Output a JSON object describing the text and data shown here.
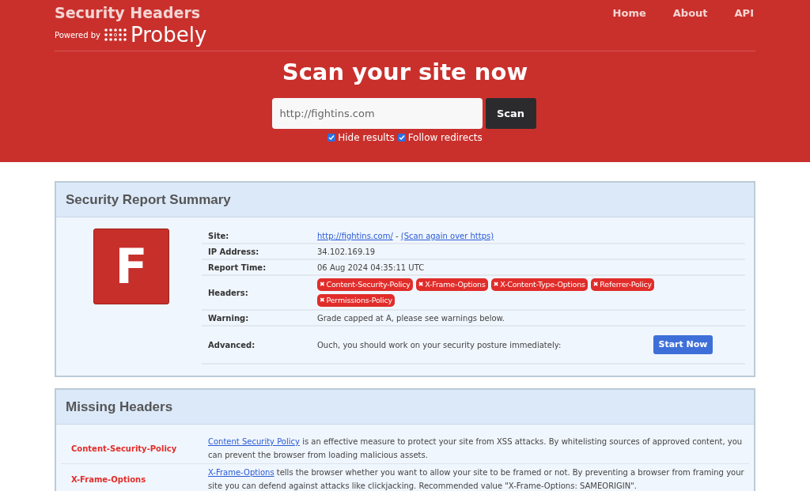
{
  "brand": {
    "title": "Security Headers",
    "powered_by": "Powered by",
    "partner": "Probely"
  },
  "nav": [
    "Home",
    "About",
    "API"
  ],
  "hero": {
    "title": "Scan your site now",
    "search": {
      "value": "http://fightins.com"
    },
    "button": "Scan",
    "options": [
      {
        "label": "Hide results",
        "checked": true
      },
      {
        "label": "Follow redirects",
        "checked": true
      }
    ]
  },
  "summary": {
    "title": "Security Report Summary",
    "grade": "F",
    "rows": [
      {
        "kind": "site",
        "label": "Site:",
        "link": "http://fightins.com/",
        "separator": " - ",
        "link2": "(Scan again over https)"
      },
      {
        "kind": "text",
        "label": "IP Address:",
        "value": "34.102.169.19"
      },
      {
        "kind": "text",
        "label": "Report Time:",
        "value": "06 Aug 2024 04:35:11 UTC"
      },
      {
        "kind": "badges",
        "label": "Headers:",
        "badges": [
          {
            "icon": "✖",
            "text": "Content-Security-Policy"
          },
          {
            "icon": "✖",
            "text": "X-Frame-Options"
          },
          {
            "icon": "✖",
            "text": "X-Content-Type-Options"
          },
          {
            "icon": "✖",
            "text": "Referrer-Policy"
          },
          {
            "icon": "✖",
            "text": "Permissions-Policy"
          }
        ]
      },
      {
        "kind": "text",
        "label": "Warning:",
        "value": "Grade capped at A, please see warnings below."
      },
      {
        "kind": "action",
        "label": "Advanced:",
        "value": "Ouch, you should work on your security posture immediately:",
        "button": "Start Now"
      }
    ]
  },
  "missing": {
    "title": "Missing Headers",
    "rows": [
      {
        "name": "Content-Security-Policy",
        "link": "Content Security Policy",
        "text": " is an effective measure to protect your site from XSS attacks. By whitelisting sources of approved content, you can prevent the browser from loading malicious assets."
      },
      {
        "name": "X-Frame-Options",
        "link": "X-Frame-Options",
        "text": " tells the browser whether you want to allow your site to be framed or not. By preventing a browser from framing your site you can defend against attacks like clickjacking. Recommended value \"X-Frame-Options: SAMEORIGIN\"."
      }
    ]
  }
}
